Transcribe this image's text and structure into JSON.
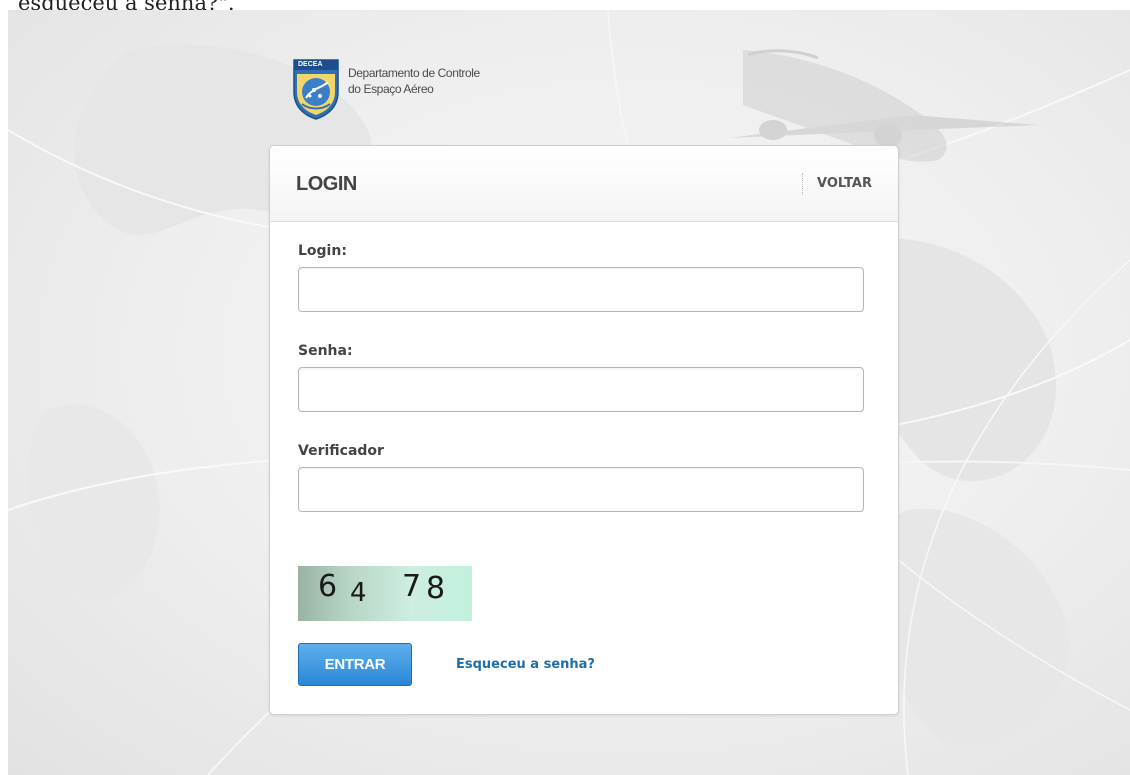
{
  "page": {
    "top_text": "esqueceu a senha?\"."
  },
  "logo": {
    "badge_text": "DECEA",
    "line1": "Departamento de Controle",
    "line2": "do Espaço Aéreo"
  },
  "login_card": {
    "title": "LOGIN",
    "back_label": "VOLTAR",
    "fields": {
      "login": {
        "label": "Login:",
        "value": "",
        "placeholder": ""
      },
      "password": {
        "label": "Senha:",
        "value": "",
        "placeholder": ""
      },
      "verifier": {
        "label": "Verificador",
        "value": "",
        "placeholder": ""
      }
    },
    "captcha": {
      "d1": "6",
      "d2": "4",
      "d3": "7",
      "d4": "8"
    },
    "submit_label": "ENTRAR",
    "forgot_label": "Esqueceu a senha?"
  },
  "colors": {
    "primary_button": "#2a86d6",
    "link": "#1f6ea8",
    "captcha_bg": "#c2f0dd"
  },
  "icons": {
    "logo": "decea-shield-icon",
    "background_plane": "airplane-icon"
  }
}
